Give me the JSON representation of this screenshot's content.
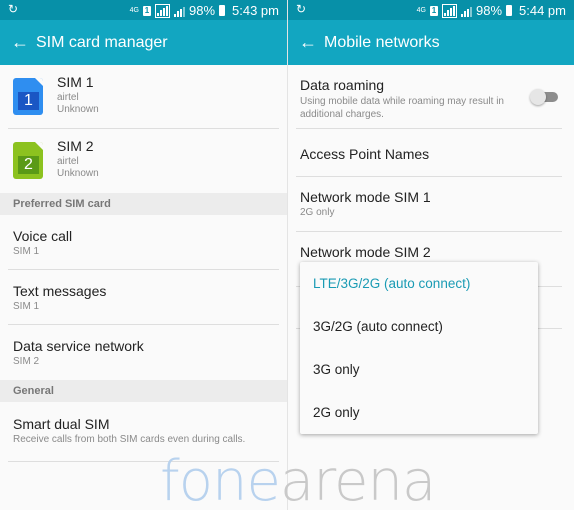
{
  "left": {
    "statusbar": {
      "time": "5:43 pm",
      "battery": "98%",
      "network": "4G"
    },
    "appbar": {
      "title": "SIM card manager"
    },
    "sims": [
      {
        "label": "SIM 1",
        "number": "1",
        "carrier": "airtel",
        "status": "Unknown",
        "color": "#2f8ef0"
      },
      {
        "label": "SIM 2",
        "number": "2",
        "carrier": "airtel",
        "status": "Unknown",
        "color": "#8cc21f"
      }
    ],
    "preferred_header": "Preferred SIM card",
    "preferred": [
      {
        "title": "Voice call",
        "value": "SIM 1"
      },
      {
        "title": "Text messages",
        "value": "SIM 1"
      },
      {
        "title": "Data service network",
        "value": "SIM 2"
      }
    ],
    "general_header": "General",
    "smart_dual_sim": {
      "title": "Smart dual SIM",
      "desc": "Receive calls from both SIM cards even during calls."
    }
  },
  "right": {
    "statusbar": {
      "time": "5:44 pm",
      "battery": "98%",
      "network": "4G"
    },
    "appbar": {
      "title": "Mobile networks"
    },
    "data_roaming": {
      "title": "Data roaming",
      "desc": "Using mobile data while roaming may result in additional charges.",
      "enabled": false
    },
    "apn": {
      "title": "Access Point Names"
    },
    "network_mode_sim1": {
      "title": "Network mode SIM 1",
      "value": "2G only"
    },
    "network_mode_sim2": {
      "title": "Network mode SIM 2"
    },
    "dropdown": {
      "options": [
        "LTE/3G/2G (auto connect)",
        "3G/2G (auto connect)",
        "3G only",
        "2G only"
      ],
      "selected": "LTE/3G/2G (auto connect)"
    }
  },
  "watermark": {
    "part1": "fone",
    "part2": "arena"
  },
  "colors": {
    "statusbar": "#0790a8",
    "appbar": "#12a6c1",
    "accent": "#1a9bb4"
  }
}
